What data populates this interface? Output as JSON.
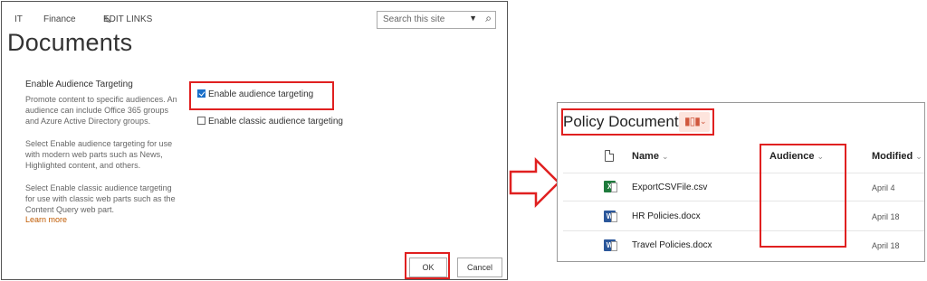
{
  "left": {
    "nav": {
      "it": "IT",
      "finance": "Finance",
      "edit_links": "EDIT LINKS"
    },
    "search": {
      "placeholder": "Search this site"
    },
    "page_title": "Documents",
    "section_title": "Enable Audience Targeting",
    "desc1": "Promote content to specific audiences. An audience can include Office 365 groups and Azure Active Directory groups.",
    "desc2": "Select Enable audience targeting for use with modern web parts such as News, Highlighted content, and others.",
    "desc3": "Select Enable classic audience targeting for use with classic web parts such as the Content Query web part.",
    "learn_more": "Learn more",
    "options": [
      {
        "label": "Enable audience targeting",
        "checked": true
      },
      {
        "label": "Enable classic audience targeting",
        "checked": false
      }
    ],
    "ok_label": "OK",
    "cancel_label": "Cancel"
  },
  "right": {
    "library_title": "Policy Documents",
    "columns": {
      "name": "Name",
      "audience": "Audience",
      "modified": "Modified"
    },
    "files": [
      {
        "name": "ExportCSVFile.csv",
        "type": "xls",
        "icon": "excel-file-icon",
        "modified": "April 4"
      },
      {
        "name": "HR Policies.docx",
        "type": "doc",
        "icon": "word-file-icon",
        "modified": "April 18"
      },
      {
        "name": "Travel Policies.docx",
        "type": "doc",
        "icon": "word-file-icon",
        "modified": "April 18"
      }
    ]
  },
  "colors": {
    "highlight": "#e02020",
    "link": "#c05a00",
    "checkbox": "#1a6fc9"
  }
}
